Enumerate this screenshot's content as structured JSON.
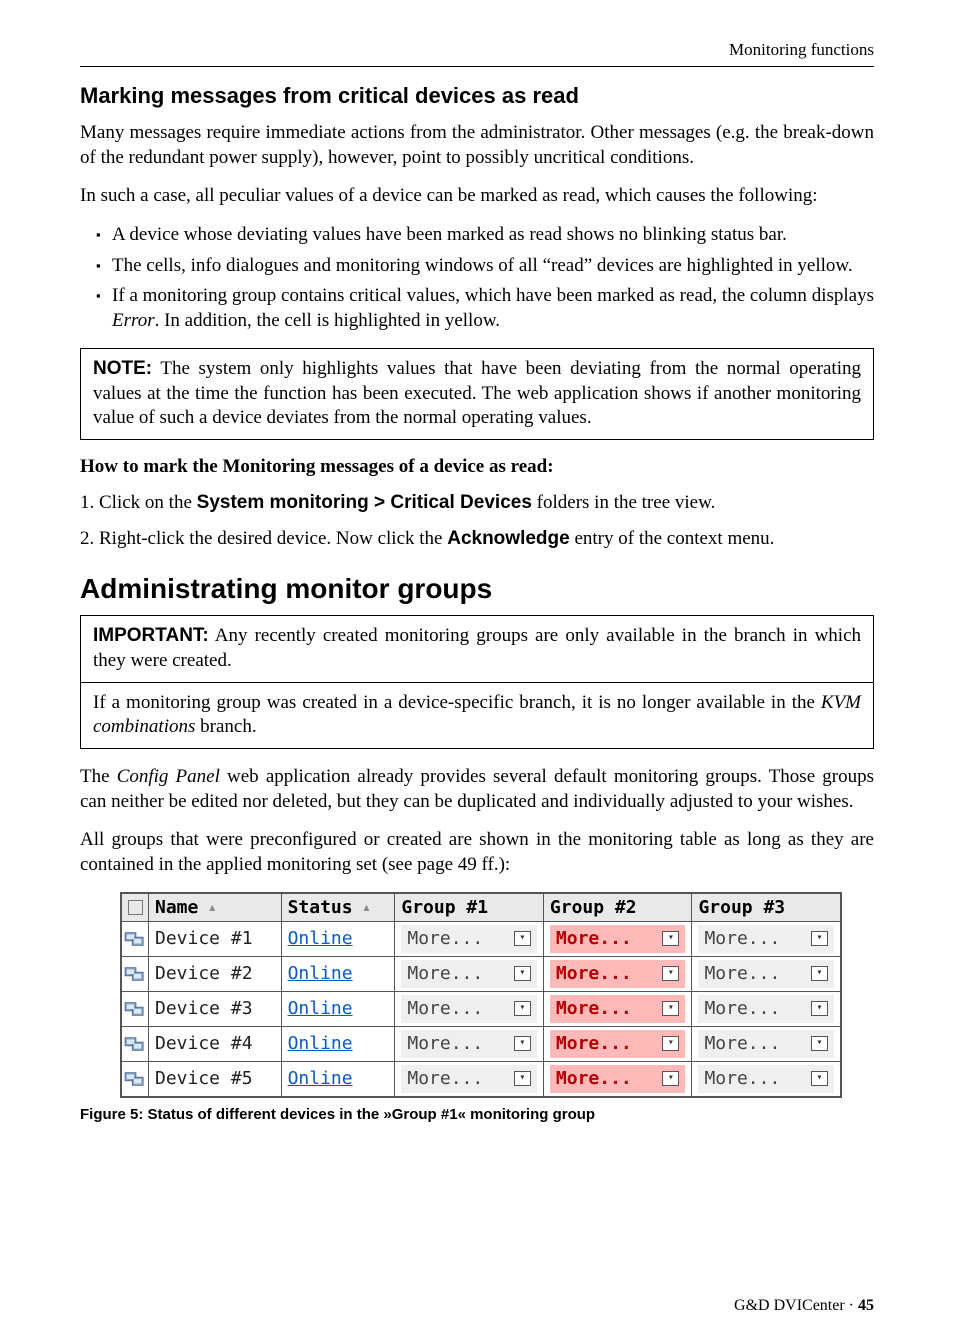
{
  "header": {
    "section": "Monitoring functions"
  },
  "section1": {
    "title": "Marking messages from critical devices as read",
    "para1": "Many messages require immediate actions from the administrator. Other messages (e.g. the break-down of the redundant power supply), however, point to possibly uncritical conditions.",
    "para2": "In such a case, all peculiar values of a device can be marked as read, which causes the following:",
    "bullets": [
      "A device whose deviating values have been marked as read shows no blinking status bar.",
      "The cells, info dialogues and monitoring windows of all “read” devices are highlighted in yellow.",
      "If a monitoring group contains critical values, which have been marked as read, the column displays Error. In addition, the cell is highlighted in yellow."
    ],
    "noteLabel": "NOTE:",
    "noteText": " The system only highlights values that have been deviating from the normal operating values at the time the function has been executed. The web application shows if another monitoring value of such a device deviates from the normal operating values.",
    "howto": "How to mark the Monitoring messages of a device as read:",
    "step1_prefix": "1.  Click on the ",
    "step1_bold": "System monitoring > Critical Devices",
    "step1_suffix": " folders in the tree view.",
    "step2_prefix": "2.  Right-click the desired device. Now click the ",
    "step2_bold": "Acknowledge",
    "step2_suffix": " entry of the context menu."
  },
  "section2": {
    "title": "Administrating monitor groups",
    "impLabel": "IMPORTANT:",
    "impText1": " Any recently created monitoring groups are only available in the branch in which they were created.",
    "impText2a": "If a monitoring group was created in a device-specific branch, it is no longer available in the ",
    "impText2b": "KVM combinations",
    "impText2c": " branch.",
    "para1a": "The ",
    "para1b": "Config Panel",
    "para1c": " web application already provides several default monitoring groups. Those groups can neither be edited nor deleted, but they can be duplicated and individually adjusted to your wishes.",
    "para2": "All groups that were preconfigured or created are shown in the monitoring table as long as they are contained in the applied monitoring set (see page 49 ff.):"
  },
  "table": {
    "headers": {
      "name": "Name",
      "status": "Status",
      "g1": "Group #1",
      "g2": "Group #2",
      "g3": "Group #3"
    },
    "moreLabel": "More...",
    "rows": [
      {
        "name": "Device #1",
        "status": "Online"
      },
      {
        "name": "Device #2",
        "status": "Online"
      },
      {
        "name": "Device #3",
        "status": "Online"
      },
      {
        "name": "Device #4",
        "status": "Online"
      },
      {
        "name": "Device #5",
        "status": "Online"
      }
    ]
  },
  "figure": {
    "caption": "Figure 5: Status of different devices in the »Group #1« monitoring group"
  },
  "footer": {
    "product": "G&D DVICenter · ",
    "page": "45"
  }
}
